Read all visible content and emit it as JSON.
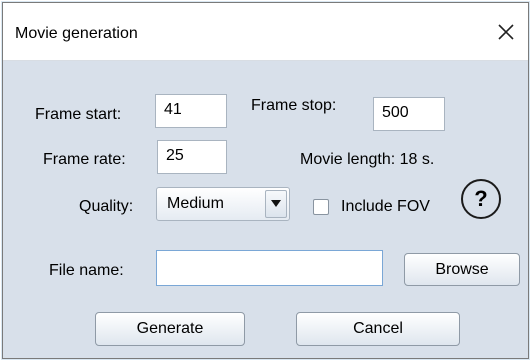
{
  "window": {
    "title": "Movie generation"
  },
  "labels": {
    "frame_start": "Frame start:",
    "frame_stop": "Frame stop:",
    "frame_rate": "Frame rate:",
    "movie_length": "Movie length: 18 s.",
    "quality": "Quality:",
    "file_name": "File name:"
  },
  "fields": {
    "frame_start": "41",
    "frame_stop": "500",
    "frame_rate": "25",
    "file_name": ""
  },
  "quality": {
    "selected": "Medium"
  },
  "checkbox": {
    "label": "Include FOV",
    "checked": false
  },
  "help": {
    "label": "?"
  },
  "buttons": {
    "browse": "Browse",
    "generate": "Generate",
    "cancel": "Cancel"
  },
  "icons": {
    "close": "close-icon",
    "dropdown": "chevron-down-icon",
    "help": "help-icon"
  }
}
